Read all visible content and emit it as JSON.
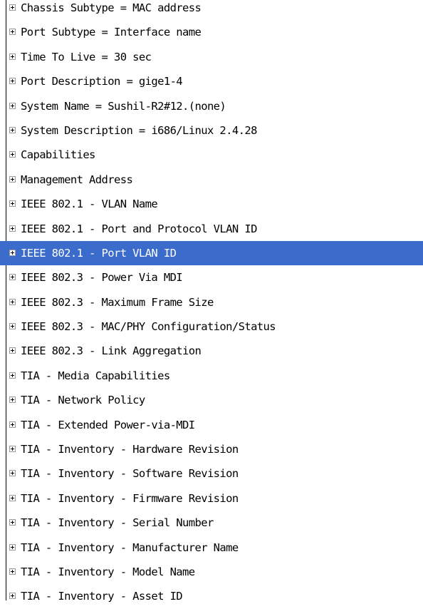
{
  "tree": {
    "selected_index": 10,
    "expander_icon": "plus-box-icon",
    "items": [
      {
        "label": "Chassis Subtype = MAC address"
      },
      {
        "label": "Port Subtype = Interface name"
      },
      {
        "label": "Time To Live = 30 sec"
      },
      {
        "label": "Port Description = gige1-4"
      },
      {
        "label": "System Name = Sushil-R2#12.(none)"
      },
      {
        "label": "System Description = i686/Linux 2.4.28"
      },
      {
        "label": "Capabilities"
      },
      {
        "label": "Management Address"
      },
      {
        "label": "IEEE 802.1 - VLAN Name"
      },
      {
        "label": "IEEE 802.1 - Port and Protocol VLAN ID"
      },
      {
        "label": "IEEE 802.1 - Port VLAN ID"
      },
      {
        "label": "IEEE 802.3 - Power Via MDI"
      },
      {
        "label": "IEEE 802.3 - Maximum Frame Size"
      },
      {
        "label": "IEEE 802.3 - MAC/PHY Configuration/Status"
      },
      {
        "label": "IEEE 802.3 - Link Aggregation"
      },
      {
        "label": "TIA - Media Capabilities"
      },
      {
        "label": "TIA - Network Policy"
      },
      {
        "label": "TIA - Extended Power-via-MDI"
      },
      {
        "label": "TIA - Inventory - Hardware Revision"
      },
      {
        "label": "TIA - Inventory - Software Revision"
      },
      {
        "label": "TIA - Inventory - Firmware Revision"
      },
      {
        "label": "TIA - Inventory - Serial Number"
      },
      {
        "label": "TIA - Inventory - Manufacturer Name"
      },
      {
        "label": "TIA - Inventory - Model Name"
      },
      {
        "label": "TIA - Inventory - Asset ID"
      }
    ]
  },
  "colors": {
    "selection_background": "#3b6ccc",
    "selection_text": "#ffffff",
    "text": "#000000",
    "background": "#ffffff"
  }
}
